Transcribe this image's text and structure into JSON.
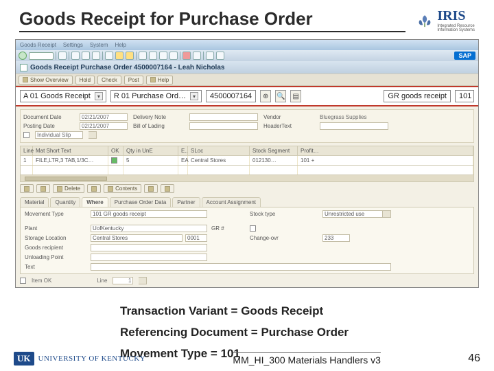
{
  "header": {
    "title": "Goods Receipt for Purchase Order",
    "logo_text": "IRIS"
  },
  "sap": {
    "menu": {
      "m1": "Goods Receipt",
      "m2": "Settings",
      "m3": "System",
      "m4": "Help"
    },
    "titlebar": "Goods Receipt Purchase Order 4500007164 - Leah Nicholas",
    "toolbar2": {
      "b1": "Show Overview",
      "b2": "Hold",
      "b3": "Check",
      "b4": "Post",
      "b5": "Help"
    },
    "sap_logo": "SAP",
    "variant": {
      "a01": "A 01 Goods Receipt",
      "r01": "R 01 Purchase Ord…",
      "po": "4500007164",
      "gr_text": "GR goods receipt",
      "mvt": "101"
    },
    "doc": {
      "l_docdate": "Document Date",
      "v_docdate": "02/21/2007",
      "l_postdate": "Posting Date",
      "v_postdate": "02/21/2007",
      "l_note": "Individual Slip",
      "l_deliv": "Delivery Note",
      "l_bill": "Bill of Lading",
      "l_vendor": "Vendor",
      "v_vendor": "Bluegrass Supplies",
      "l_header": "HeaderText"
    },
    "grid": {
      "h_line": "Line",
      "h_mat": "Mat Short Text",
      "h_ok": "OK",
      "h_qty": "Qty in UnE",
      "h_e": "E..",
      "h_sloc": "SLoc",
      "h_batch": "Stock Segment",
      "h_prof": "Profit…",
      "r_line": "1",
      "r_desc": "FILE,LTR,3 TAB,1/3C…",
      "r_qty": "5",
      "r_un": "EA",
      "r_sloc": "Central Stores",
      "r_prof": "101 +",
      "r_seg": "012130…"
    },
    "btnrow": {
      "b1": "",
      "b2": "",
      "b3": "Delete",
      "b4": "",
      "b5": "Contents",
      "b6": "",
      "b7": ""
    },
    "tabs": {
      "t1": "Material",
      "t2": "Quantity",
      "t3": "Where",
      "t4": "Purchase Order Data",
      "t5": "Partner",
      "t6": "Account Assignment"
    },
    "where": {
      "l_mvt": "Movement Type",
      "v_mvt": "101 GR goods receipt",
      "l_stock": "Stock type",
      "v_stock": "Unrestricted use",
      "l_plant": "Plant",
      "v_plant": "UofKentucky",
      "l_gri": "GR #",
      "l_sloc": "Storage Location",
      "v_sloc": "Central Stores",
      "v_slcode": "0001",
      "l_chg": "Change-ovr",
      "v_chg": "233",
      "l_gr": "Goods recipient",
      "l_unl": "Unloading Point",
      "l_text": "Text"
    },
    "foot": {
      "l_item": "Item OK",
      "l_line": "Line",
      "v_line": "1"
    }
  },
  "annot": {
    "l1": "Transaction Variant = Goods Receipt",
    "l2": "Referencing Document = Purchase Order",
    "l3": "Movement Type = 101"
  },
  "footer": {
    "uk_badge": "UK",
    "uk_text": "UNIVERSITY OF KENTUCKY",
    "module": "MM_HI_300 Materials Handlers v3",
    "page": "46"
  }
}
